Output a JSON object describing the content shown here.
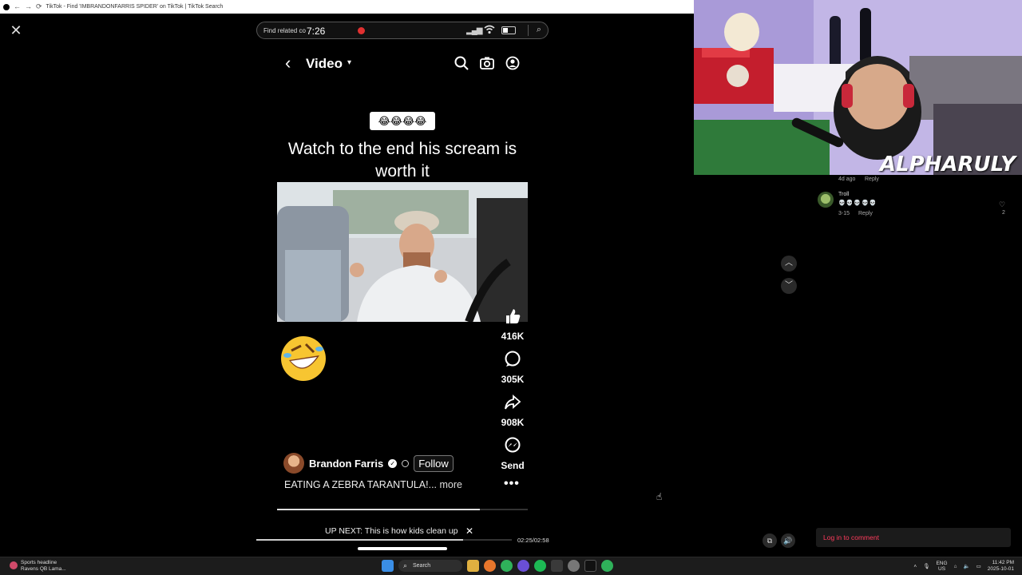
{
  "browser": {
    "tab_title": "TikTok - Find 'IMBRANDONFARRIS SPIDER' on TikTok | TikTok Search"
  },
  "overlay": {
    "close_glyph": "✕"
  },
  "phone": {
    "findbar_text": "Find related co",
    "clock": "7:26",
    "app_title": "Video",
    "sticker": "😂😂😂😂",
    "caption": "Watch to the end his scream is worth it",
    "big_emoji": "🤣",
    "actions": [
      {
        "label": "416K",
        "icon": "thumbs-up-icon"
      },
      {
        "label": "305K",
        "icon": "comment-icon"
      },
      {
        "label": "908K",
        "icon": "share-icon"
      },
      {
        "label": "Send",
        "icon": "messenger-icon"
      }
    ],
    "author": "Brandon Farris",
    "follow_label": "Follow",
    "description": "EATING A ZEBRA TARANTULA!...",
    "more_label": "more",
    "video_progress": 0.81,
    "up_next": "UP NEXT: This is how kids clean up",
    "timecode": "02:25/02:58",
    "playback_progress": 0.81
  },
  "webcam": {
    "watermark": "ALPHARULY"
  },
  "comments": {
    "first_meta": "4d ago",
    "first_reply": "Reply",
    "second_user": "Troll",
    "second_text": "💀💀💀💀💀",
    "second_date": "3-15",
    "second_reply": "Reply",
    "second_likes": "2"
  },
  "login_label": "Log in to comment",
  "taskbar": {
    "news_title": "Sports headline",
    "news_sub": "Ravens QB Lama...",
    "search_label": "Search",
    "lang_1": "ENG",
    "lang_2": "US",
    "time": "11:42 PM",
    "date": "2025-10-01"
  },
  "colors": {
    "accent_red": "#ff3b5c",
    "record_red": "#e03030"
  }
}
